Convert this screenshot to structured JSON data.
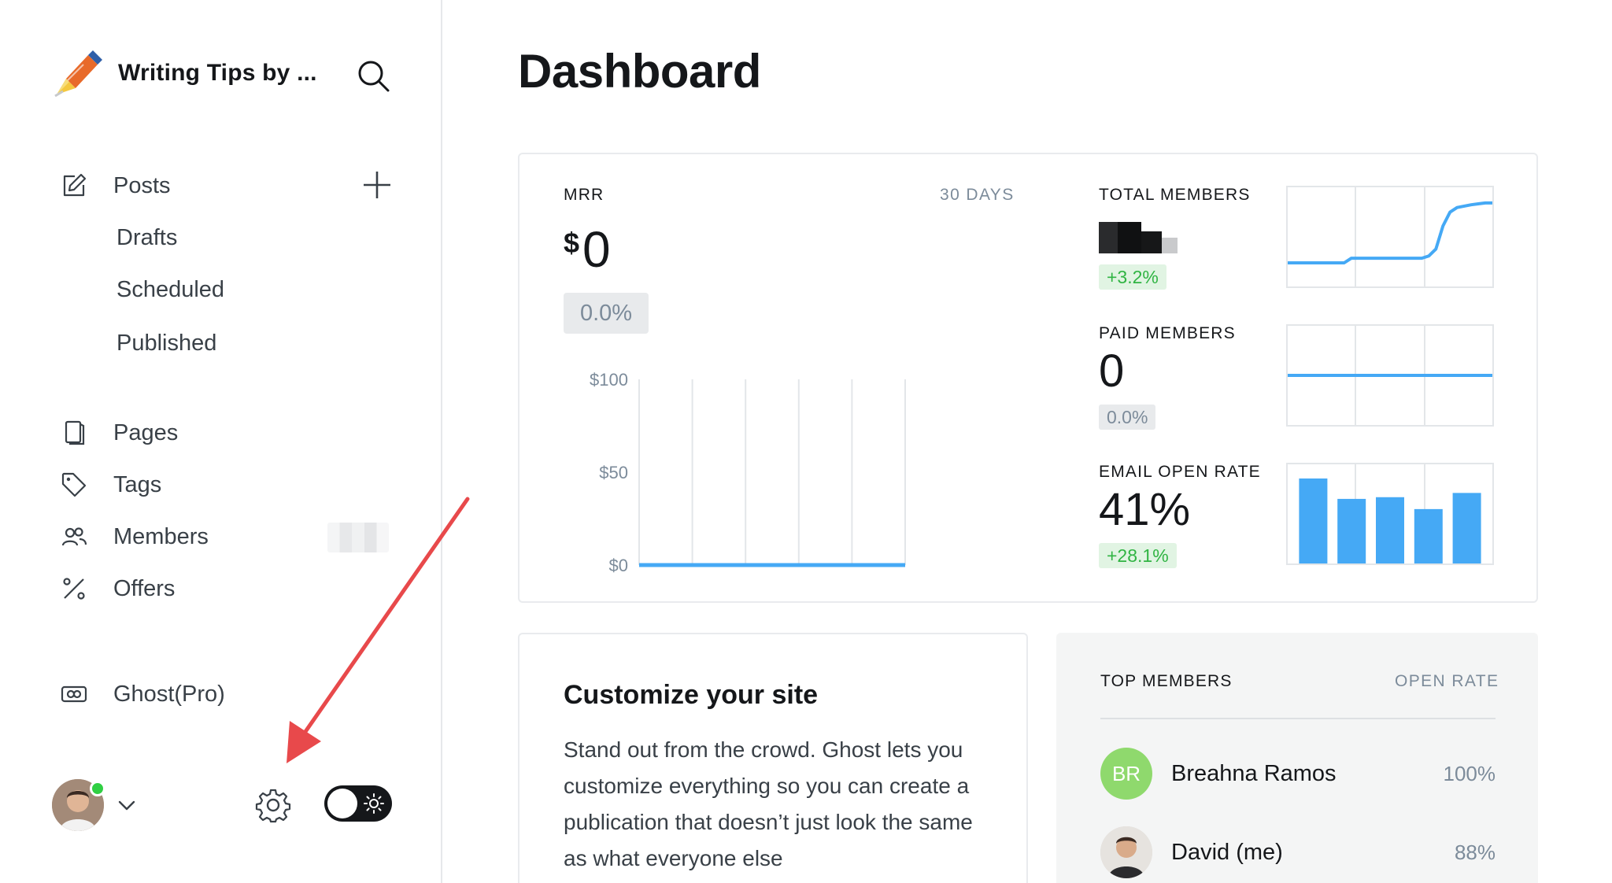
{
  "sidebar": {
    "brand_title": "Writing Tips by ...",
    "nav": {
      "posts": "Posts",
      "drafts": "Drafts",
      "scheduled": "Scheduled",
      "published": "Published",
      "pages": "Pages",
      "tags": "Tags",
      "members": "Members",
      "offers": "Offers",
      "ghost_pro": "Ghost(Pro)"
    }
  },
  "main": {
    "title": "Dashboard",
    "mrr": {
      "label": "MRR",
      "range": "30 DAYS",
      "currency": "$",
      "value": "0",
      "delta": "0.0%"
    },
    "total_members": {
      "label": "TOTAL MEMBERS",
      "delta": "+3.2%"
    },
    "paid_members": {
      "label": "PAID MEMBERS",
      "value": "0",
      "delta": "0.0%"
    },
    "email_open_rate": {
      "label": "EMAIL OPEN RATE",
      "value": "41%",
      "delta": "+28.1%"
    },
    "customize": {
      "title": "Customize your site",
      "body": "Stand out from the crowd. Ghost lets you customize everything so you can create a publication that doesn’t just look the same as what everyone else"
    },
    "top_members": {
      "title": "TOP MEMBERS",
      "rate_header": "OPEN RATE",
      "rows": [
        {
          "initials": "BR",
          "name": "Breahna Ramos",
          "rate": "100%"
        },
        {
          "initials": "",
          "name": "David (me)",
          "rate": "88%"
        }
      ]
    }
  },
  "colors": {
    "accent": "#45a9f5",
    "positive": "#30b443",
    "avatar_green": "#8fd96d",
    "online": "#30cf43",
    "arrow": "#e8494b"
  },
  "chart_data": [
    {
      "type": "line",
      "x": [
        0,
        1,
        2,
        3,
        4,
        5
      ],
      "values": [
        0,
        0,
        0,
        0,
        0,
        0
      ],
      "ytick_labels": [
        "$100",
        "$50",
        "$0"
      ],
      "ylim": [
        0,
        100
      ]
    },
    {
      "type": "line",
      "x": [
        0,
        1,
        2,
        3,
        4,
        5,
        6,
        7,
        8,
        9,
        10,
        11,
        12,
        13,
        14,
        15,
        16,
        17,
        18,
        19,
        20,
        21,
        22,
        23,
        24,
        25,
        26,
        27,
        28,
        29
      ],
      "values": [
        0,
        0,
        0,
        0,
        0,
        0,
        0,
        0,
        0,
        1,
        1,
        1,
        1,
        1,
        1,
        1,
        1,
        1,
        1,
        1,
        1.5,
        3,
        8,
        11,
        12,
        12.3,
        12.6,
        12.8,
        13,
        13
      ],
      "ylim": [
        0,
        14
      ]
    },
    {
      "type": "line",
      "x": [
        0,
        29
      ],
      "values": [
        0,
        0
      ],
      "ylim": [
        -1,
        1
      ]
    },
    {
      "type": "bar",
      "categories": [
        "1",
        "2",
        "3",
        "4",
        "5"
      ],
      "values": [
        100,
        76,
        78,
        64,
        83
      ],
      "ylim": [
        0,
        100
      ]
    }
  ]
}
